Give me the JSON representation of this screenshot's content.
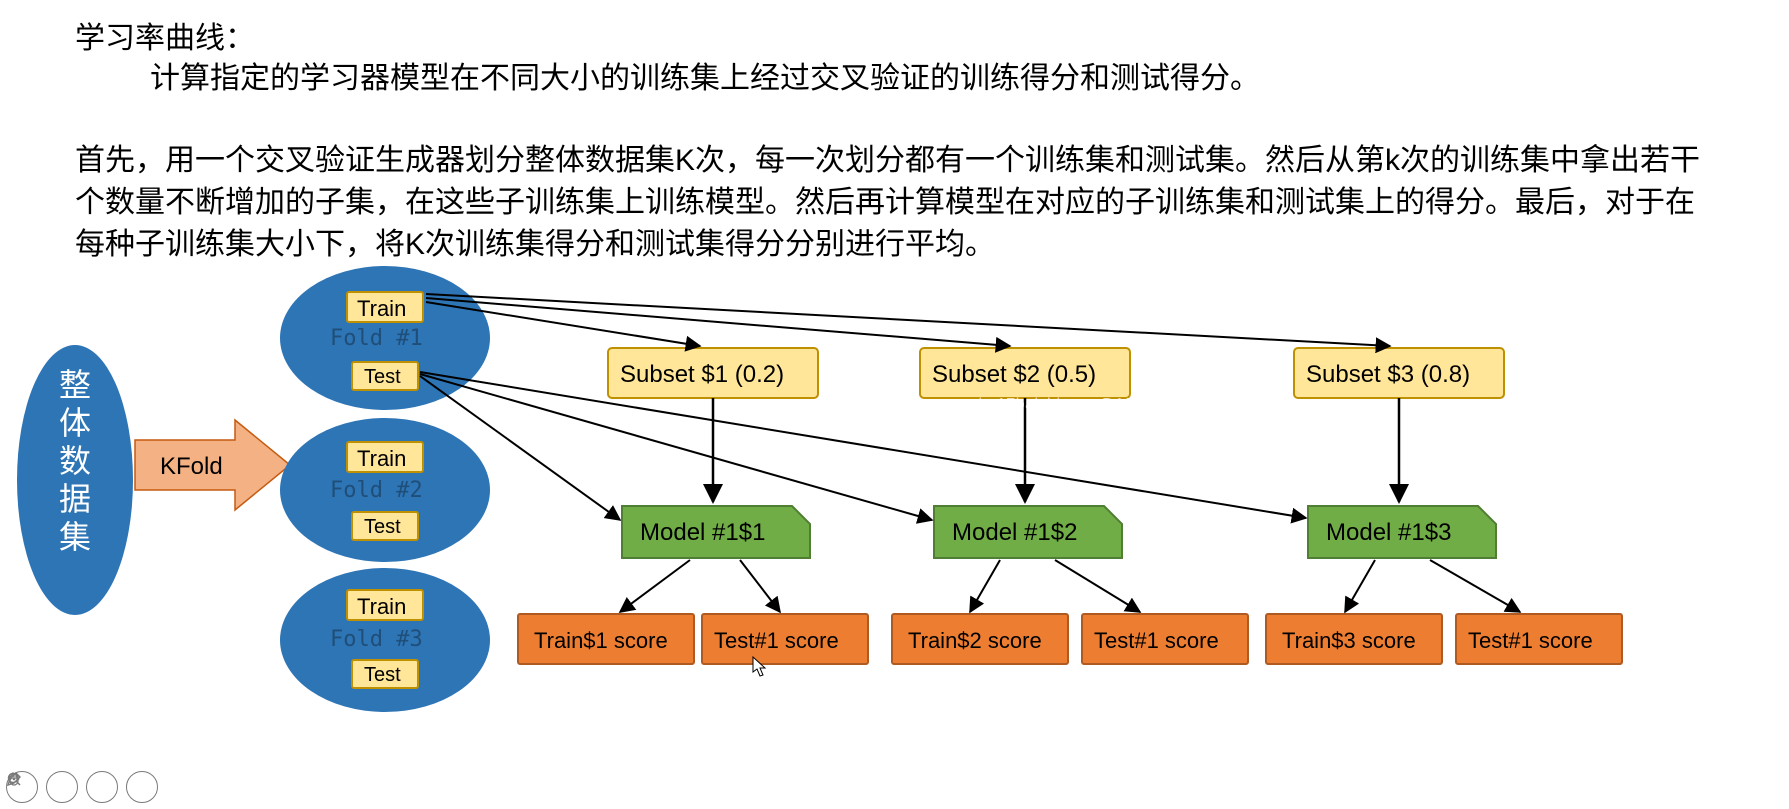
{
  "text": {
    "title": "学习率曲线：",
    "sub": "计算指定的学习器模型在不同大小的训练集上经过交叉验证的训练得分和测试得分。",
    "para": "首先，用一个交叉验证生成器划分整体数据集K次，每一次划分都有一个训练集和测试集。然后从第k次的训练集中拿出若干个数量不断增加的子集，在这些子训练集上训练模型。然后再计算模型在对应的子训练集和测试集上的得分。最后，对于在每种子训练集大小下，将K次训练集得分和测试集得分分别进行平均。"
  },
  "diagram": {
    "dataset_label": "整体数据集",
    "kfold_label": "KFold",
    "folds": [
      {
        "name": "Fold #1",
        "train": "Train",
        "test": "Test"
      },
      {
        "name": "Fold #2",
        "train": "Train",
        "test": "Test"
      },
      {
        "name": "Fold #3",
        "train": "Train",
        "test": "Test"
      }
    ],
    "subsets": [
      {
        "label": "Subset $1 (0.2)"
      },
      {
        "label": "Subset $2 (0.5)"
      },
      {
        "label": "Subset $3 (0.8)"
      }
    ],
    "models": [
      {
        "label": "Model #1$1"
      },
      {
        "label": "Model #1$2"
      },
      {
        "label": "Model #1$3"
      }
    ],
    "scores": [
      {
        "train": "Train$1 score",
        "test": "Test#1 score"
      },
      {
        "train": "Train$2 score",
        "test": "Test#1 score"
      },
      {
        "train": "Train$3 score",
        "test": "Test#1 score"
      }
    ]
  },
  "watermark": "vip.17baishi.com DAN11",
  "colors": {
    "blue": "#2E75B6",
    "yellow_fill": "#FFE699",
    "yellow_stroke": "#BF9000",
    "green_fill": "#70AD47",
    "green_stroke": "#507E32",
    "orange_fill": "#ED7D31",
    "orange_stroke": "#AE5A21",
    "arrow_fill": "#F4B183",
    "fold_text": "#1F4E79"
  }
}
